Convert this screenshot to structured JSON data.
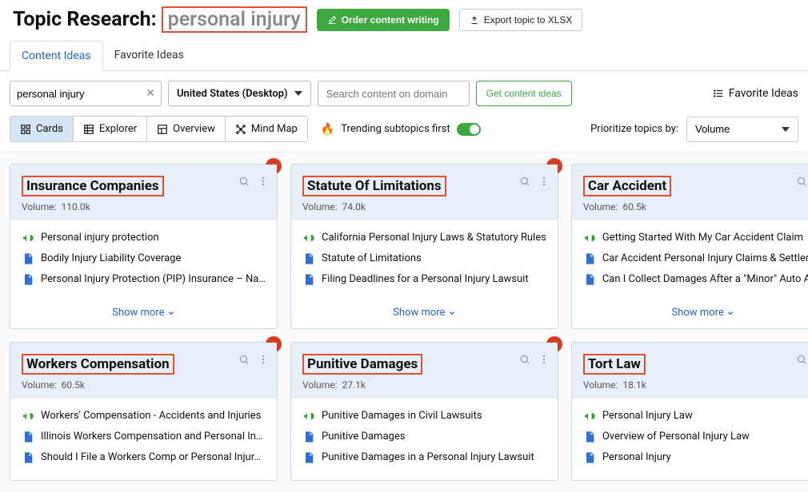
{
  "header": {
    "title_prefix": "Topic Research:",
    "keyword": "personal injury",
    "order_btn": "Order content writing",
    "export_btn": "Export topic to XLSX"
  },
  "main_tabs": {
    "content_ideas": "Content Ideas",
    "favorite_ideas": "Favorite Ideas"
  },
  "controls": {
    "keyword_value": "personal injury",
    "country": "United States (Desktop)",
    "domain_placeholder": "Search content on domain",
    "get_ideas": "Get content ideas",
    "fav_link": "Favorite Ideas"
  },
  "viewbar": {
    "cards": "Cards",
    "explorer": "Explorer",
    "overview": "Overview",
    "mindmap": "Mind Map",
    "trending_label": "Trending subtopics first",
    "prio_label": "Prioritize topics by:",
    "prio_value": "Volume"
  },
  "vol_label": "Volume:",
  "showmore": "Show more",
  "cards": [
    {
      "title": "Insurance Companies",
      "volume": "110.0k",
      "items": [
        {
          "icon": "meg",
          "text": "Personal injury protection"
        },
        {
          "icon": "doc",
          "text": "Bodily Injury Liability Coverage"
        },
        {
          "icon": "doc",
          "text": "Personal Injury Protection (PIP) Insurance – Na…"
        }
      ]
    },
    {
      "title": "Statute Of Limitations",
      "volume": "74.0k",
      "items": [
        {
          "icon": "meg",
          "text": "California Personal Injury Laws & Statutory Rules"
        },
        {
          "icon": "doc",
          "text": "Statute of Limitations"
        },
        {
          "icon": "doc",
          "text": "Filing Deadlines for a Personal Injury Lawsuit"
        }
      ]
    },
    {
      "title": "Car Accident",
      "volume": "60.5k",
      "items": [
        {
          "icon": "meg",
          "text": "Getting Started With My Car Accident Claim"
        },
        {
          "icon": "doc",
          "text": "Car Accident Personal Injury Claims & Settlem…"
        },
        {
          "icon": "doc",
          "text": "Can I Collect Damages After a \"Minor\" Auto Ac…"
        }
      ]
    },
    {
      "title": "Workers Compensation",
      "volume": "60.5k",
      "items": [
        {
          "icon": "meg",
          "text": "Workers' Compensation - Accidents and Injuries"
        },
        {
          "icon": "doc",
          "text": "Illinois Workers Compensation and Personal In…"
        },
        {
          "icon": "doc",
          "text": "Should I File a Workers Comp or Personal Injur…"
        }
      ]
    },
    {
      "title": "Punitive Damages",
      "volume": "27.1k",
      "items": [
        {
          "icon": "meg",
          "text": "Punitive Damages in Civil Lawsuits"
        },
        {
          "icon": "doc",
          "text": "Punitive Damages"
        },
        {
          "icon": "doc",
          "text": "Punitive Damages in a Personal Injury Lawsuit"
        }
      ]
    },
    {
      "title": "Tort Law",
      "volume": "18.1k",
      "items": [
        {
          "icon": "meg",
          "text": "Personal Injury Law"
        },
        {
          "icon": "doc",
          "text": "Overview of Personal Injury Law"
        },
        {
          "icon": "doc",
          "text": "Personal Injury"
        }
      ]
    }
  ]
}
